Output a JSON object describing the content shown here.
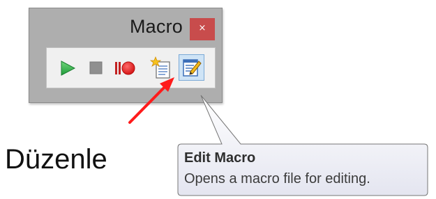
{
  "macro_window": {
    "title": "Macro",
    "close_label": "×",
    "toolbar": {
      "buttons": [
        {
          "name": "play",
          "icon": "play-icon",
          "color": "#2ea84a"
        },
        {
          "name": "stop",
          "icon": "stop-icon",
          "color": "#8c8c8c"
        },
        {
          "name": "record",
          "icon": "record-icon",
          "color": "#e01818"
        },
        {
          "name": "new",
          "icon": "new-macro-icon",
          "color": "#f2b21f"
        },
        {
          "name": "edit",
          "icon": "edit-macro-icon",
          "color": "#3c6fb8",
          "selected": true
        }
      ]
    }
  },
  "annotation": {
    "label": "Düzenle",
    "arrow_color": "#ff1b1b"
  },
  "tooltip": {
    "title": "Edit Macro",
    "description": "Opens a macro file for editing."
  }
}
